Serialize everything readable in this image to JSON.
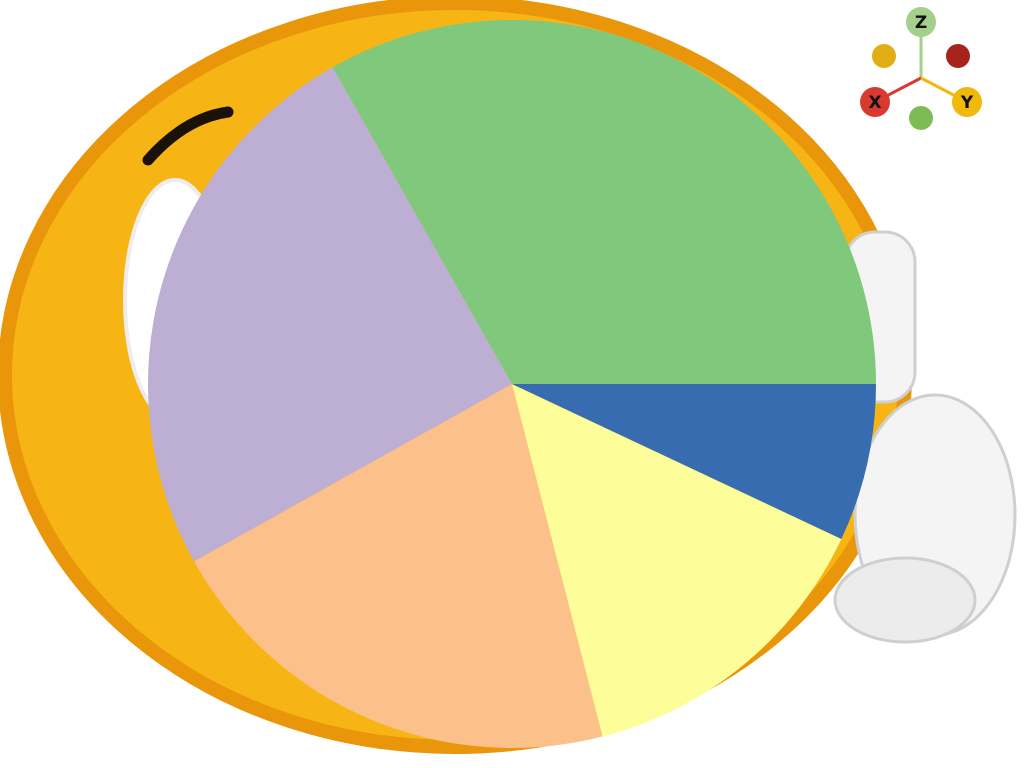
{
  "scene": {
    "background_color": "#ffffff",
    "emoji": {
      "icon": "thumbs-up-smiley-icon",
      "face_color": "#f7b515",
      "rim_color": "#e9960a",
      "glove_color": "#f4f4f4"
    }
  },
  "gizmo": {
    "axes": [
      {
        "key": "x",
        "label": "X",
        "color": "#d93a30"
      },
      {
        "key": "y",
        "label": "Y",
        "color": "#f0b90c"
      },
      {
        "key": "z",
        "label": "Z",
        "color": "#a3d08a"
      }
    ],
    "negative_axes": [
      {
        "key": "neg-x",
        "color": "#a6241b"
      },
      {
        "key": "neg-y",
        "color": "#e0ae14"
      },
      {
        "key": "neg-z",
        "color": "#7dbb55"
      }
    ]
  },
  "chart_data": {
    "type": "pie",
    "start_angle_deg": 0,
    "direction": "counterclockwise",
    "slices": [
      {
        "value": 33.2,
        "color": "#7fc87c"
      },
      {
        "value": 24.9,
        "color": "#bdaed4"
      },
      {
        "value": 20.9,
        "color": "#fcc18a"
      },
      {
        "value": 14.0,
        "color": "#fdfe99"
      },
      {
        "value": 7.0,
        "color": "#386cb0"
      }
    ]
  }
}
